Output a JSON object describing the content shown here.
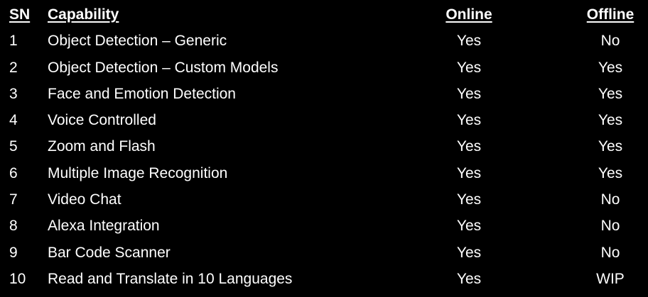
{
  "table": {
    "headers": {
      "sn": "SN",
      "capability": "Capability",
      "online": "Online",
      "offline": "Offline"
    },
    "rows": [
      {
        "sn": "1",
        "capability": "Object Detection – Generic",
        "online": "Yes",
        "offline": "No"
      },
      {
        "sn": "2",
        "capability": "Object Detection – Custom Models",
        "online": "Yes",
        "offline": "Yes"
      },
      {
        "sn": "3",
        "capability": "Face and Emotion Detection",
        "online": "Yes",
        "offline": "Yes"
      },
      {
        "sn": "4",
        "capability": "Voice Controlled",
        "online": "Yes",
        "offline": "Yes"
      },
      {
        "sn": "5",
        "capability": "Zoom and Flash",
        "online": "Yes",
        "offline": "Yes"
      },
      {
        "sn": "6",
        "capability": "Multiple Image Recognition",
        "online": "Yes",
        "offline": "Yes"
      },
      {
        "sn": "7",
        "capability": "Video Chat",
        "online": "Yes",
        "offline": "No"
      },
      {
        "sn": "8",
        "capability": "Alexa Integration",
        "online": "Yes",
        "offline": "No"
      },
      {
        "sn": "9",
        "capability": "Bar Code Scanner",
        "online": "Yes",
        "offline": "No"
      },
      {
        "sn": "10",
        "capability": "Read and Translate in 10 Languages",
        "online": "Yes",
        "offline": "WIP"
      }
    ]
  }
}
